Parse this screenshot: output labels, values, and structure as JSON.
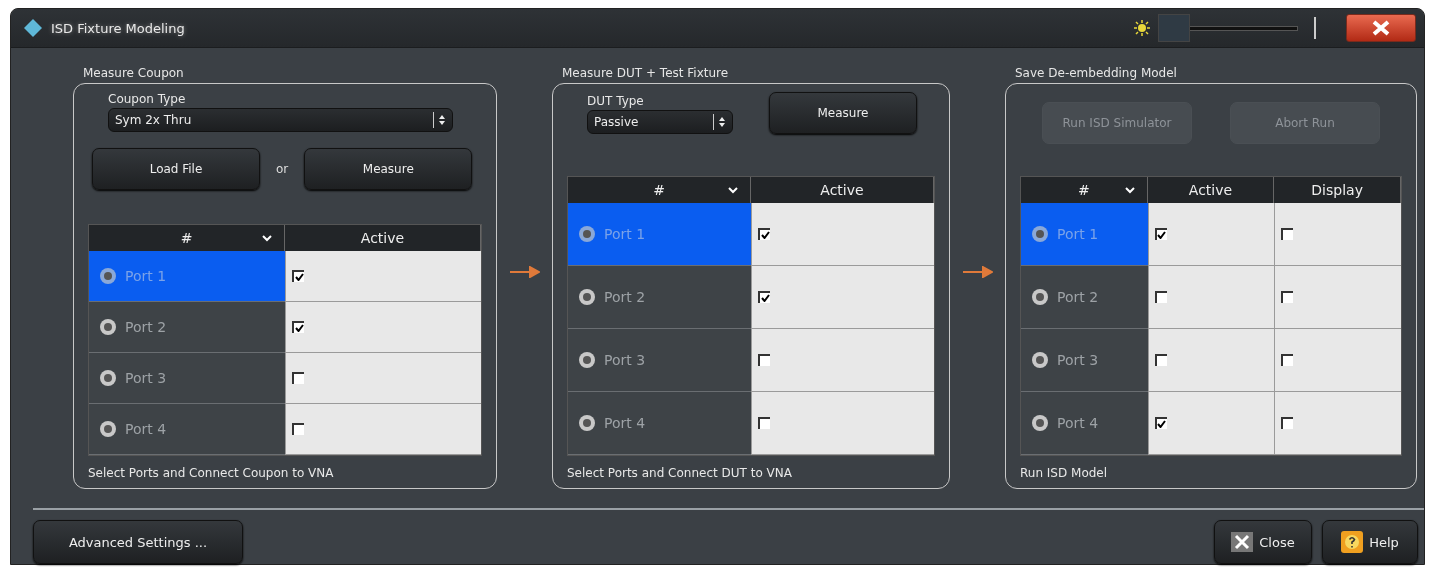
{
  "window": {
    "title": "ISD Fixture Modeling",
    "brightness": {
      "level": 0
    }
  },
  "panels": [
    {
      "kind": "coupon",
      "title": "Measure Coupon",
      "dropdown": {
        "label": "Coupon Type",
        "value": "Sym 2x Thru"
      },
      "buttons": [
        {
          "label": "Load File",
          "disabled": false
        },
        {
          "label": "Measure",
          "disabled": false
        }
      ],
      "separator": "or",
      "columns": [
        "#",
        "Active"
      ],
      "rows": [
        {
          "port": "Port 1",
          "selected": true,
          "checks": [
            true
          ]
        },
        {
          "port": "Port 2",
          "selected": false,
          "checks": [
            true
          ]
        },
        {
          "port": "Port 3",
          "selected": false,
          "checks": [
            false
          ]
        },
        {
          "port": "Port 4",
          "selected": false,
          "checks": [
            false
          ]
        }
      ],
      "footer": "Select Ports and Connect Coupon to VNA"
    },
    {
      "kind": "dut",
      "title": "Measure DUT + Test Fixture",
      "dropdown": {
        "label": "DUT Type",
        "value": "Passive"
      },
      "buttons": [
        {
          "label": "Measure",
          "disabled": false
        }
      ],
      "columns": [
        "#",
        "Active"
      ],
      "rows": [
        {
          "port": "Port 1",
          "selected": true,
          "checks": [
            true
          ]
        },
        {
          "port": "Port 2",
          "selected": false,
          "checks": [
            true
          ]
        },
        {
          "port": "Port 3",
          "selected": false,
          "checks": [
            false
          ]
        },
        {
          "port": "Port 4",
          "selected": false,
          "checks": [
            false
          ]
        }
      ],
      "footer": "Select Ports and Connect DUT to VNA"
    },
    {
      "kind": "save",
      "title": "Save De-embedding Model",
      "buttons": [
        {
          "label": "Run ISD Simulator",
          "disabled": true
        },
        {
          "label": "Abort Run",
          "disabled": true
        }
      ],
      "columns": [
        "#",
        "Active",
        "Display"
      ],
      "rows": [
        {
          "port": "Port 1",
          "selected": true,
          "checks": [
            true,
            false
          ]
        },
        {
          "port": "Port 2",
          "selected": false,
          "checks": [
            false,
            false
          ]
        },
        {
          "port": "Port 3",
          "selected": false,
          "checks": [
            false,
            false
          ]
        },
        {
          "port": "Port 4",
          "selected": false,
          "checks": [
            true,
            false
          ]
        }
      ],
      "footer": "Run ISD Model"
    }
  ],
  "bottom": {
    "advanced": "Advanced Settings ...",
    "close": "Close",
    "help": "Help"
  }
}
